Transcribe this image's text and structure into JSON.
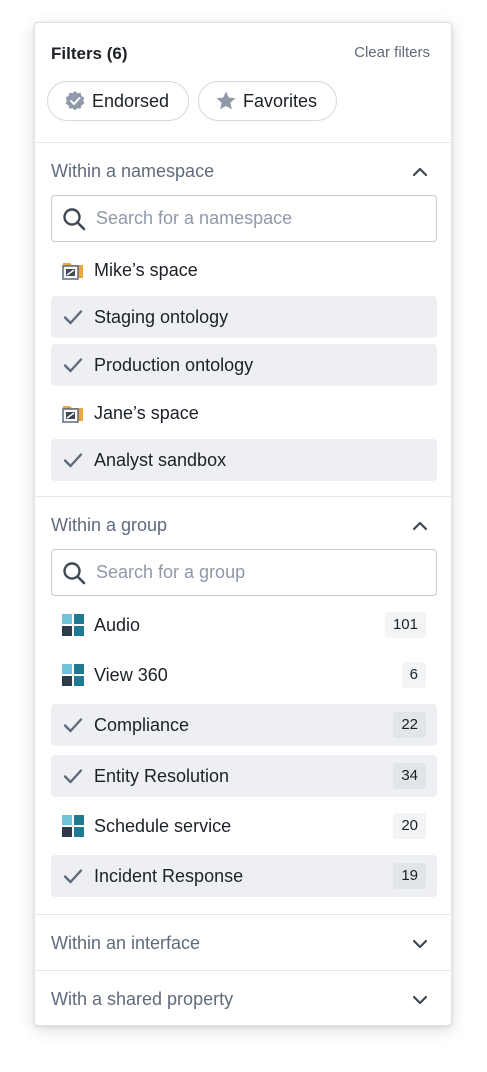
{
  "header": {
    "title": "Filters (6)",
    "clear_label": "Clear filters"
  },
  "chips": [
    {
      "label": "Endorsed",
      "icon": "endorsed-badge-icon"
    },
    {
      "label": "Favorites",
      "icon": "star-icon"
    }
  ],
  "namespace": {
    "title": "Within a namespace",
    "search_placeholder": "Search for a namespace",
    "items": [
      {
        "label": "Mike’s space",
        "selected": false,
        "icon": "folder-icon"
      },
      {
        "label": "Staging ontology",
        "selected": true,
        "icon": "check-icon"
      },
      {
        "label": "Production ontology",
        "selected": true,
        "icon": "check-icon"
      },
      {
        "label": "Jane’s space",
        "selected": false,
        "icon": "folder-icon"
      },
      {
        "label": "Analyst sandbox",
        "selected": true,
        "icon": "check-icon"
      }
    ]
  },
  "group": {
    "title": "Within a group",
    "search_placeholder": "Search for a group",
    "items": [
      {
        "label": "Audio",
        "count": "101",
        "selected": false,
        "icon": "group-grid-icon"
      },
      {
        "label": "View 360",
        "count": "6",
        "selected": false,
        "icon": "group-grid-icon"
      },
      {
        "label": "Compliance",
        "count": "22",
        "selected": true,
        "icon": "check-icon"
      },
      {
        "label": "Entity Resolution",
        "count": "34",
        "selected": true,
        "icon": "check-icon"
      },
      {
        "label": "Schedule service",
        "count": "20",
        "selected": false,
        "icon": "group-grid-icon"
      },
      {
        "label": "Incident Response",
        "count": "19",
        "selected": true,
        "icon": "check-icon"
      }
    ]
  },
  "interface": {
    "title": "Within an interface"
  },
  "shared_property": {
    "title": "With a shared property"
  },
  "colors": {
    "muted_text": "#5f6b7c",
    "selected_row": "#edeff2",
    "check": "#5f6b7c",
    "folder": "#e8a93a",
    "group_light": "#6fc3d6",
    "group_dark": "#2d3b48"
  }
}
